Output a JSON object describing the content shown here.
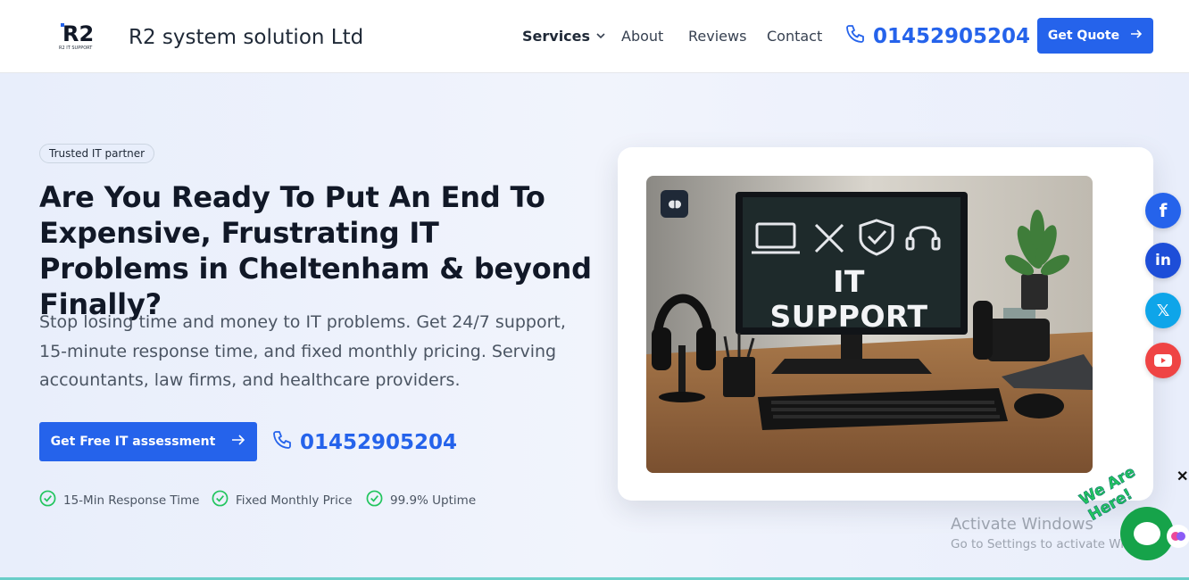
{
  "header": {
    "brand": "R2 system solution Ltd",
    "logo_text": "R2 IT SUPPORT",
    "nav": {
      "services": "Services",
      "about": "About",
      "reviews": "Reviews",
      "contact": "Contact"
    },
    "phone": "01452905204",
    "quote_button": "Get Quote"
  },
  "hero": {
    "badge": "Trusted IT partner",
    "headline": "Are You Ready To Put An End To Expensive, Frustrating IT Problems in Cheltenham & beyond Finally?",
    "subtext": "Stop losing time and money to IT problems. Get 24/7 support, 15-minute response time, and fixed monthly pricing. Serving accountants, law firms, and healthcare providers.",
    "cta_button": "Get Free IT assessment",
    "phone": "01452905204",
    "features": [
      "15-Min Response Time",
      "Fixed Monthly Price",
      "99.9% Uptime"
    ],
    "image_text": "IT SUPPORT"
  },
  "socials": {
    "facebook": "f",
    "linkedin": "in",
    "x": "𝕏"
  },
  "watermark": {
    "title": "Activate Windows",
    "subtitle": "Go to Settings to activate Windows."
  },
  "chat": {
    "tag": "We Are Here!",
    "close": "✕"
  },
  "colors": {
    "accent": "#2563eb",
    "check": "#22c55e",
    "chat": "#16a34a"
  }
}
